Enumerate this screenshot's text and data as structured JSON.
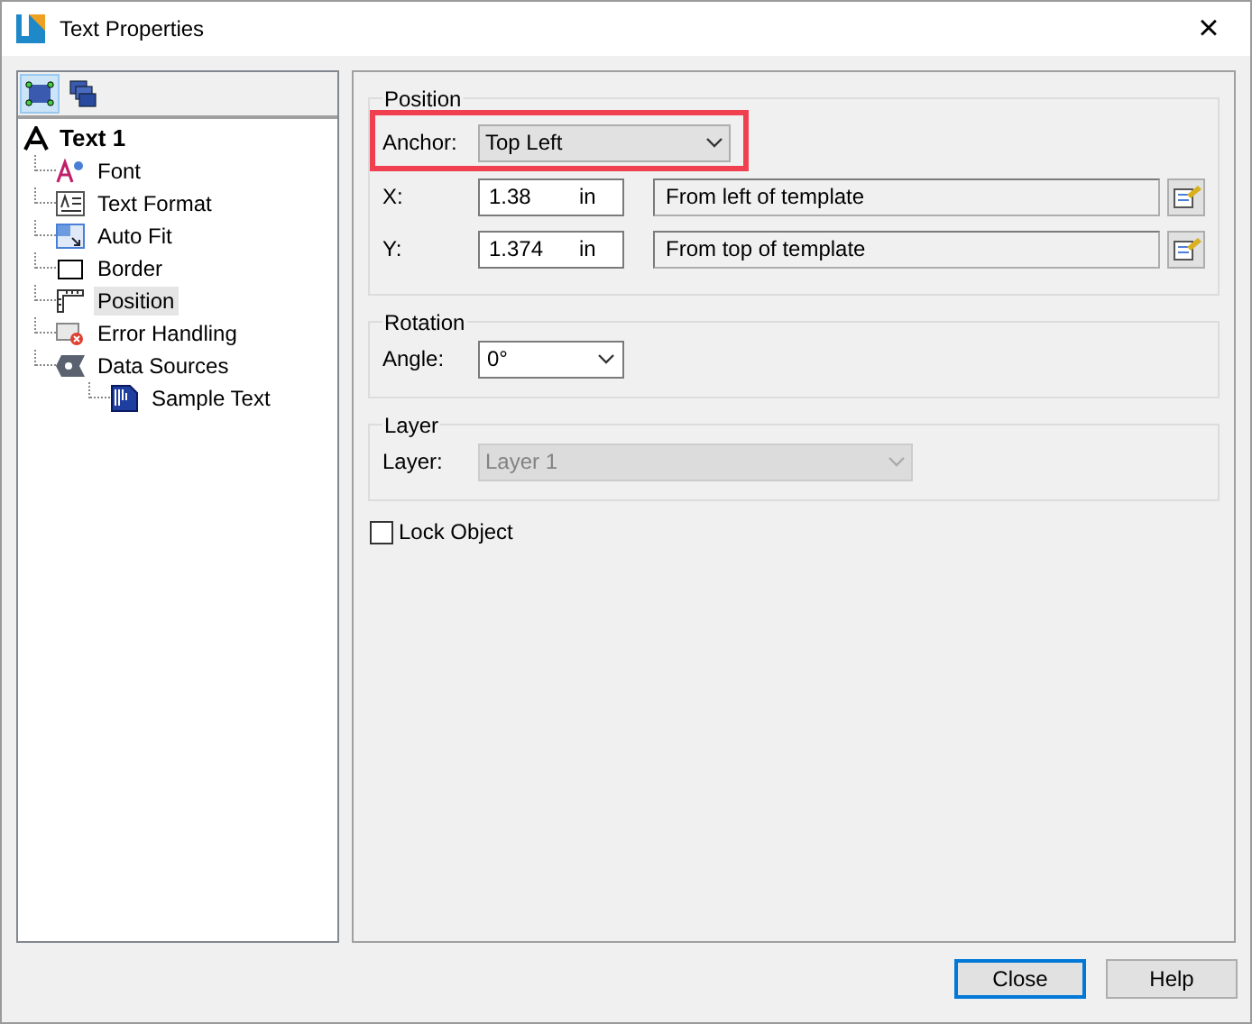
{
  "window": {
    "title": "Text Properties",
    "close": "×"
  },
  "toolbar": [
    {
      "kind": "select",
      "selected": true
    },
    {
      "kind": "layers",
      "selected": false
    }
  ],
  "tree": {
    "label": "Text 1",
    "children": [
      {
        "label": "Font",
        "kind": "font",
        "selected": false
      },
      {
        "label": "Text Format",
        "kind": "format",
        "selected": false
      },
      {
        "label": "Auto Fit",
        "kind": "autofit",
        "selected": false
      },
      {
        "label": "Border",
        "kind": "border",
        "selected": false
      },
      {
        "label": "Position",
        "kind": "position",
        "selected": true
      },
      {
        "label": "Error Handling",
        "kind": "error",
        "selected": false
      },
      {
        "label": "Data Sources",
        "kind": "datasource",
        "selected": false,
        "children": [
          {
            "label": "Sample Text",
            "kind": "sample",
            "selected": false
          }
        ]
      }
    ]
  },
  "position": {
    "title": "Position",
    "anchor_label": "Anchor:",
    "anchor": "Top Left",
    "highlighted": true,
    "rows": [
      {
        "label": "X:",
        "value": "1.38",
        "unit": "in",
        "reference": "From left of template"
      },
      {
        "label": "Y:",
        "value": "1.374",
        "unit": "in",
        "reference": "From top of template"
      }
    ]
  },
  "rotation": {
    "title": "Rotation",
    "label": "Angle:",
    "value": "0°"
  },
  "layer": {
    "title": "Layer",
    "label": "Layer:",
    "value": "Layer 1",
    "disabled": true
  },
  "lock_object": {
    "label": "Lock Object",
    "checked": false
  },
  "buttons": [
    {
      "label": "Close",
      "default": true
    },
    {
      "label": "Help",
      "default": false
    }
  ]
}
